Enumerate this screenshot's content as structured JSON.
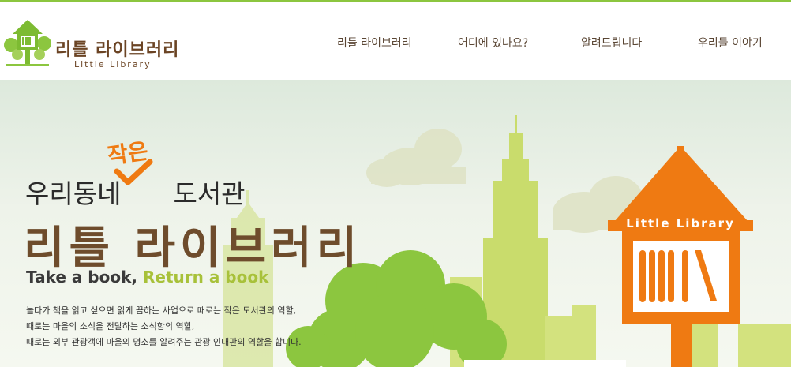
{
  "brand": {
    "name": "리틀 라이브러리",
    "subtitle": "Little Library",
    "colors": {
      "green": "#8cc63f",
      "brown": "#6e4c2c",
      "orange": "#ef7a12"
    }
  },
  "nav": {
    "items": [
      {
        "label": "리틀 라이브러리"
      },
      {
        "label": "어디에 있나요?"
      },
      {
        "label": "알려드립니다"
      },
      {
        "label": "우리들 이야기"
      }
    ]
  },
  "hero": {
    "headline_part1": "우리동네",
    "headline_part2": "도서관",
    "headline_accent": "작은",
    "title": "리틀 라이브러리",
    "slogan_part1": "Take a book,",
    "slogan_part2": "Return a book",
    "desc_lines": [
      "놀다가 책을 읽고 싶으면 읽게 끔하는 사업으로 때로는 작은 도서관의 역할,",
      "때로는 마을의 소식을 전달하는 소식함의 역할,",
      "때로는 외부 관광객에 마을의 명소를 알려주는 관광 인내판의 역할을 합니다."
    ],
    "sign_label": "Little Library"
  }
}
